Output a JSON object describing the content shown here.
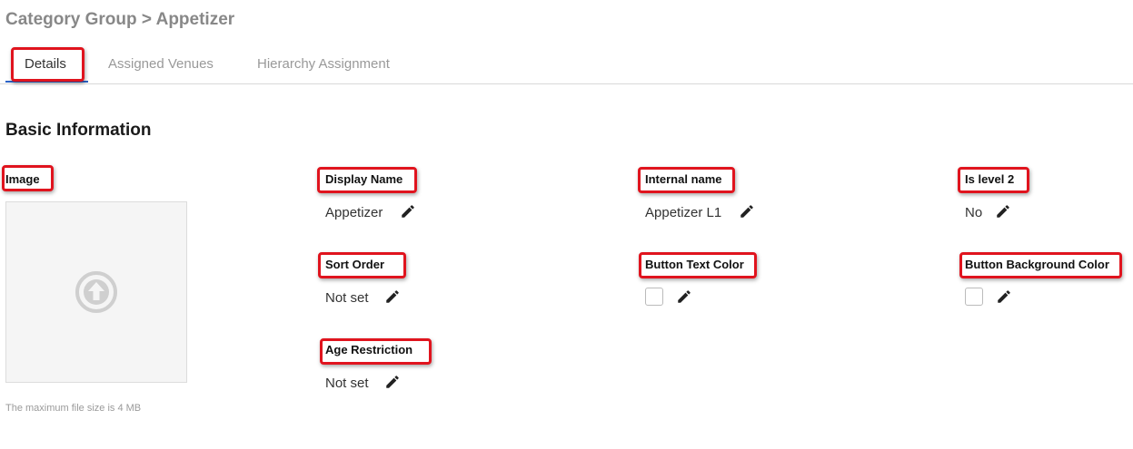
{
  "breadcrumb": {
    "parent": "Category Group",
    "separator": ">",
    "current": "Appetizer"
  },
  "tabs": [
    {
      "label": "Details",
      "active": true
    },
    {
      "label": "Assigned Venues",
      "active": false
    },
    {
      "label": "Hierarchy Assignment",
      "active": false
    }
  ],
  "section": {
    "title": "Basic Information"
  },
  "image": {
    "label": "Image",
    "max_size_note": "The maximum file size is 4 MB",
    "icon": "upload-arrow-icon"
  },
  "fields": {
    "display_name": {
      "label": "Display Name",
      "value": "Appetizer"
    },
    "internal_name": {
      "label": "Internal name",
      "value": "Appetizer L1"
    },
    "is_level_2": {
      "label": "Is level 2",
      "value": "No"
    },
    "sort_order": {
      "label": "Sort Order",
      "value": "Not set"
    },
    "button_text_color": {
      "label": "Button Text Color",
      "value": "#ffffff"
    },
    "button_background_color": {
      "label": "Button Background Color",
      "value": "#ffffff"
    },
    "age_restriction": {
      "label": "Age Restriction",
      "value": "Not set"
    }
  },
  "colors": {
    "highlight": "#e0141e",
    "active_tab_underline": "#2b63c8",
    "muted_text": "#888888"
  }
}
